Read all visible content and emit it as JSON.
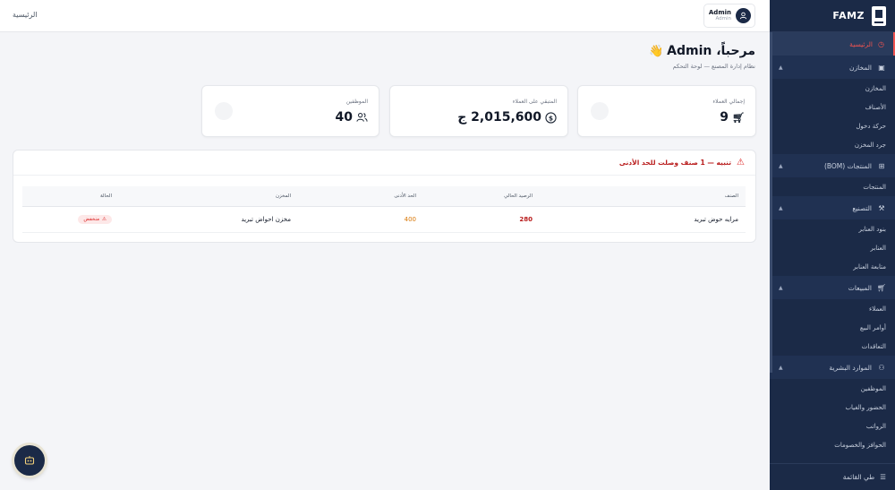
{
  "sidebar": {
    "brand": "FAMZ",
    "home": "الرئيسية",
    "groups": [
      {
        "label": "المخازن",
        "icon": "box-icon",
        "items": [
          "المخازن",
          "الأصناف",
          "حركة دخول",
          "جرد المخزن"
        ]
      },
      {
        "label": "المنتجات (BOM)",
        "icon": "grid-icon",
        "items": [
          "المنتجات"
        ]
      },
      {
        "label": "التصنيع",
        "icon": "wrench-icon",
        "items": [
          "بنود العنابر",
          "العنابر",
          "متابعة العنابر"
        ]
      },
      {
        "label": "المبيعات",
        "icon": "cart-icon",
        "items": [
          "العملاء",
          "أوامر البيع",
          "التعاقدات"
        ]
      },
      {
        "label": "الموارد البشرية",
        "icon": "users-icon",
        "items": [
          "الموظفين",
          "الحضور والغياب",
          "الرواتب",
          "الحوافز والخصومات"
        ]
      }
    ],
    "footer": "طي القائمة"
  },
  "topbar": {
    "breadcrumb": "الرئيسية",
    "user_name": "Admin",
    "user_role": "Admin"
  },
  "welcome": {
    "title": "مرحباً، Admin",
    "subtitle": "نظام إدارة المصنع — لوحة التحكم"
  },
  "stats": [
    {
      "label": "إجمالي العملاء",
      "value": "9",
      "icon": "cart-icon"
    },
    {
      "label": "المتبقي على العملاء",
      "value": "2,015,600 ج",
      "icon": "dollar-icon"
    },
    {
      "label": "الموظفين",
      "value": "40",
      "icon": "users-icon"
    }
  ],
  "alert": {
    "title": "تنبيه — 1 صنف وصلت للحد الأدنى",
    "columns": [
      "الصنف",
      "الرصيد الحالي",
      "الحد الأدنى",
      "المخزن",
      "الحالة"
    ],
    "rows": [
      {
        "item": "مرايه حوض تبريد",
        "current": "280",
        "minimum": "400",
        "warehouse": "مخزن احواض تبريد",
        "status": "منخفض"
      }
    ]
  },
  "colors": {
    "sidebar": "#1b2a47",
    "accent": "#ef5350",
    "danger": "#dc2626",
    "warning": "#d97706"
  }
}
